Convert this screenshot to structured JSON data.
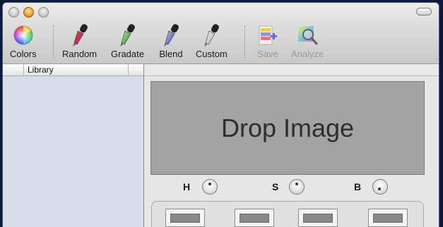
{
  "window": {
    "controls": [
      "close",
      "minimize",
      "zoom"
    ]
  },
  "toolbar": {
    "items": [
      {
        "label": "Colors",
        "icon": "color-wheel-icon",
        "enabled": true
      },
      {
        "label": "Random",
        "icon": "eyedropper-icon",
        "color": "#c03098",
        "enabled": true
      },
      {
        "label": "Gradate",
        "icon": "eyedropper-icon",
        "color": "#2f9e2f",
        "enabled": true
      },
      {
        "label": "Blend",
        "icon": "eyedropper-icon",
        "color": "#6b6bd1",
        "enabled": true
      },
      {
        "label": "Custom",
        "icon": "eyedropper-icon",
        "color": "#b8b8b8",
        "enabled": true
      },
      {
        "label": "Save",
        "icon": "save-palette-icon",
        "enabled": false
      },
      {
        "label": "Analyze",
        "icon": "analyze-magnifier-icon",
        "enabled": false
      }
    ]
  },
  "sidebar": {
    "header": "Library"
  },
  "main": {
    "drop_label": "Drop Image",
    "hsb": [
      {
        "label": "H",
        "icon": "hue-knob-icon"
      },
      {
        "label": "S",
        "icon": "saturation-knob-icon"
      },
      {
        "label": "B",
        "icon": "brightness-knob-icon"
      }
    ],
    "swatch_color": "#888888"
  }
}
